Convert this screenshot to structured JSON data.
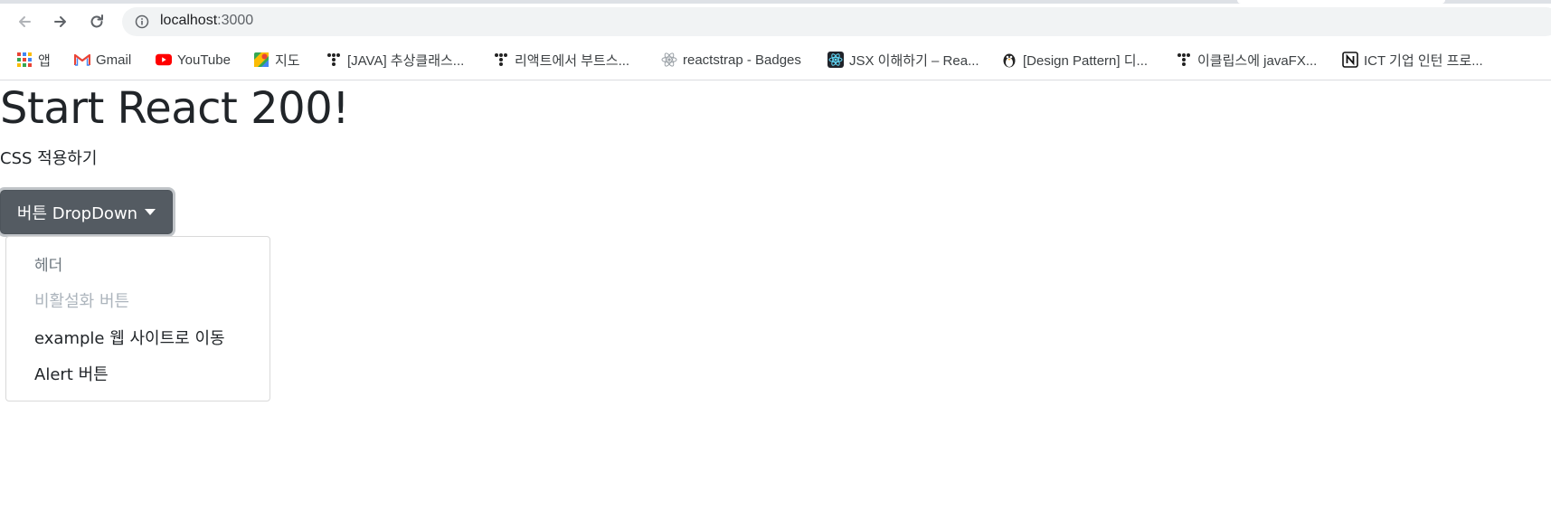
{
  "browser": {
    "url_host": "localhost",
    "url_port": ":3000",
    "bookmarks": [
      {
        "label": "앱",
        "icon": "apps-grid-icon"
      },
      {
        "label": "Gmail",
        "icon": "gmail-icon"
      },
      {
        "label": "YouTube",
        "icon": "youtube-icon"
      },
      {
        "label": "지도",
        "icon": "maps-icon"
      },
      {
        "label": "[JAVA] 추상클래스...",
        "icon": "tistory-icon"
      },
      {
        "label": "리액트에서 부트스...",
        "icon": "tistory-icon"
      },
      {
        "label": "reactstrap - Badges",
        "icon": "react-icon"
      },
      {
        "label": "JSX 이해하기 – Rea...",
        "icon": "react-dark-icon"
      },
      {
        "label": "[Design Pattern] 디...",
        "icon": "penguin-icon"
      },
      {
        "label": "이클립스에 javaFX...",
        "icon": "tistory-icon"
      },
      {
        "label": "ICT 기업 인턴 프로...",
        "icon": "notion-icon"
      }
    ]
  },
  "page": {
    "title": "Start React 200!",
    "subtitle": "CSS 적용하기"
  },
  "dropdown": {
    "toggle_label": "버튼 DropDown",
    "header": "헤더",
    "disabled_item": "비활설화 버튼",
    "link_item": "example 웹 사이트로 이동",
    "alert_item": "Alert 버튼"
  },
  "colors": {
    "toggle_bg": "#545b62",
    "disabled_text": "#adb5bd",
    "header_text": "#6c757d"
  }
}
